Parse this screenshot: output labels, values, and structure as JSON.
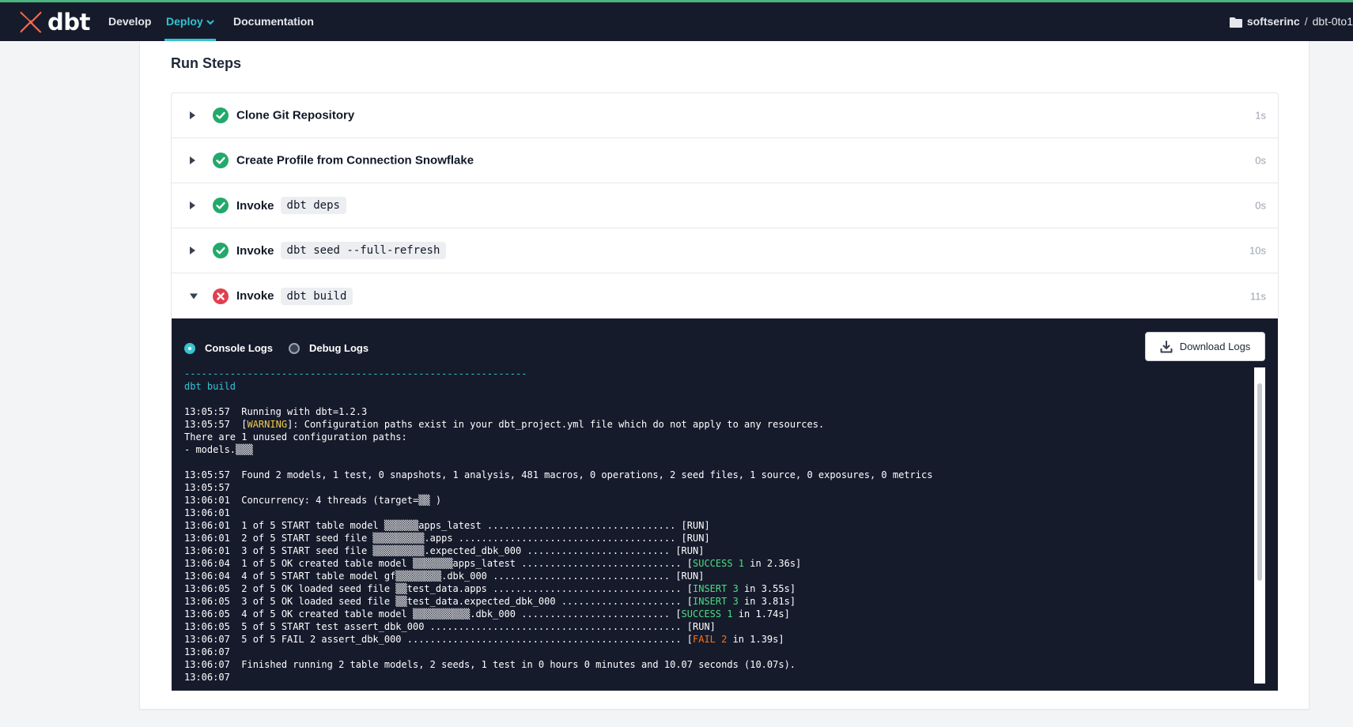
{
  "nav": {
    "logo_text": "dbt",
    "items": [
      {
        "label": "Develop",
        "active": false
      },
      {
        "label": "Deploy",
        "active": true
      },
      {
        "label": "Documentation",
        "active": false
      }
    ],
    "breadcrumb": {
      "account": "softserinc",
      "separator": "/",
      "project": "dbt-0to1"
    }
  },
  "colors": {
    "nav_bg": "#161b2c",
    "accent": "#36c2cf",
    "success": "#22a96b",
    "error": "#e0404f",
    "brand": "#ff694a"
  },
  "run_steps": {
    "title": "Run Steps",
    "steps": [
      {
        "label": "Clone Git Repository",
        "command": "",
        "status": "success",
        "duration": "1s",
        "expanded": false
      },
      {
        "label": "Create Profile from Connection Snowflake",
        "command": "",
        "status": "success",
        "duration": "0s",
        "expanded": false
      },
      {
        "label": "Invoke",
        "command": "dbt deps",
        "status": "success",
        "duration": "0s",
        "expanded": false
      },
      {
        "label": "Invoke",
        "command": "dbt seed --full-refresh",
        "status": "success",
        "duration": "10s",
        "expanded": false
      },
      {
        "label": "Invoke",
        "command": "dbt build",
        "status": "error",
        "duration": "11s",
        "expanded": true
      }
    ]
  },
  "logs": {
    "console_label": "Console Logs",
    "debug_label": "Debug Logs",
    "selected": "console",
    "download_label": "Download Logs",
    "lines": [
      [
        {
          "t": "------------------------------------------------------------",
          "c": "cyan"
        }
      ],
      [
        {
          "t": "dbt build",
          "c": "cyan"
        }
      ],
      [
        {
          "t": ""
        }
      ],
      [
        {
          "t": "13:05:57  Running with dbt=1.2.3"
        }
      ],
      [
        {
          "t": "13:05:57  ["
        },
        {
          "t": "WARNING",
          "c": "yellow"
        },
        {
          "t": "]: Configuration paths exist in your dbt_project.yml file which do not apply to any resources."
        }
      ],
      [
        {
          "t": "There are 1 unused configuration paths:"
        }
      ],
      [
        {
          "t": "- models.▒▒▒"
        }
      ],
      [
        {
          "t": ""
        }
      ],
      [
        {
          "t": "13:05:57  Found 2 models, 1 test, 0 snapshots, 1 analysis, 481 macros, 0 operations, 2 seed files, 1 source, 0 exposures, 0 metrics"
        }
      ],
      [
        {
          "t": "13:05:57"
        }
      ],
      [
        {
          "t": "13:06:01  Concurrency: 4 threads (target=▒▒ )"
        }
      ],
      [
        {
          "t": "13:06:01"
        }
      ],
      [
        {
          "t": "13:06:01  1 of 5 START table model ▒▒▒▒▒▒apps_latest ................................. [RUN]"
        }
      ],
      [
        {
          "t": "13:06:01  2 of 5 START seed file ▒▒▒▒▒▒▒▒▒.apps ...................................... [RUN]"
        }
      ],
      [
        {
          "t": "13:06:01  3 of 5 START seed file ▒▒▒▒▒▒▒▒▒.expected_dbk_000 ......................... [RUN]"
        }
      ],
      [
        {
          "t": "13:06:04  1 of 5 OK created table model ▒▒▒▒▒▒▒apps_latest ............................ ["
        },
        {
          "t": "SUCCESS 1",
          "c": "green"
        },
        {
          "t": " in 2.36s]"
        }
      ],
      [
        {
          "t": "13:06:04  4 of 5 START table model gf▒▒▒▒▒▒▒▒.dbk_000 ............................... [RUN]"
        }
      ],
      [
        {
          "t": "13:06:05  2 of 5 OK loaded seed file ▒▒test_data.apps ................................. ["
        },
        {
          "t": "INSERT 3",
          "c": "green"
        },
        {
          "t": " in 3.55s]"
        }
      ],
      [
        {
          "t": "13:06:05  3 of 5 OK loaded seed file ▒▒test_data.expected_dbk_000 ..................... ["
        },
        {
          "t": "INSERT 3",
          "c": "green"
        },
        {
          "t": " in 3.81s]"
        }
      ],
      [
        {
          "t": "13:06:05  4 of 5 OK created table model ▒▒▒▒▒▒▒▒▒▒.dbk_000 .......................... ["
        },
        {
          "t": "SUCCESS 1",
          "c": "green"
        },
        {
          "t": " in 1.74s]"
        }
      ],
      [
        {
          "t": "13:06:05  5 of 5 START test assert_dbk_000 ............................................ [RUN]"
        }
      ],
      [
        {
          "t": "13:06:07  5 of 5 FAIL 2 assert_dbk_000 ................................................ ["
        },
        {
          "t": "FAIL 2",
          "c": "orange"
        },
        {
          "t": " in 1.39s]"
        }
      ],
      [
        {
          "t": "13:06:07"
        }
      ],
      [
        {
          "t": "13:06:07  Finished running 2 table models, 2 seeds, 1 test in 0 hours 0 minutes and 10.07 seconds (10.07s)."
        }
      ],
      [
        {
          "t": "13:06:07"
        }
      ]
    ]
  }
}
